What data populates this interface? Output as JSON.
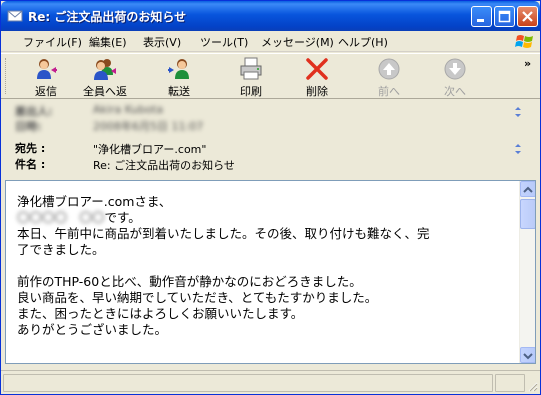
{
  "window": {
    "title": "Re: ご注文品出荷のお知らせ",
    "icons": [
      "envelope-icon",
      "minimize-icon",
      "maximize-icon",
      "close-icon"
    ]
  },
  "menu": {
    "items": [
      "ファイル(F)",
      "編集(E)",
      "表示(V)",
      "ツール(T)",
      "メッセージ(M)",
      "ヘルプ(H)"
    ]
  },
  "toolbar": {
    "buttons": [
      {
        "label": "返信",
        "icon": "reply-icon",
        "enabled": true
      },
      {
        "label": "全員へ返信",
        "icon": "reply-all-icon",
        "enabled": true
      },
      {
        "label": "転送",
        "icon": "forward-icon",
        "enabled": true
      },
      {
        "label": "印刷",
        "icon": "printer-icon",
        "enabled": true
      },
      {
        "label": "削除",
        "icon": "delete-icon",
        "enabled": true
      },
      {
        "label": "前へ",
        "icon": "previous-icon",
        "enabled": false
      },
      {
        "label": "次へ",
        "icon": "next-icon",
        "enabled": false
      }
    ],
    "overflow": "»"
  },
  "header": {
    "from_label": "差出人:",
    "from_value": "Akira Kubota",
    "date_label": "日時:",
    "date_value": "2008年6月5日 11:07",
    "to_label": "宛先 :",
    "to_value": "\"浄化槽ブロアー.com\"",
    "subject_label": "件名 :",
    "subject_value": "Re: ご注文品出荷のお知らせ"
  },
  "body": {
    "lines": [
      "浄化槽ブロアー.comさま、",
      "〇〇〇〇　〇〇です。",
      "本日、午前中に商品が到着いたしました。その後、取り付けも難なく、完",
      "了できました。",
      "",
      "前作のTHP-60と比べ、動作音が静かなのにおどろきました。",
      "良い商品を、早い納期でしていただき、とてもたすかりました。",
      "また、困ったときにはよろしくお願いいたします。",
      "ありがとうございました。"
    ],
    "redacted_line_1_prefix": "〇〇〇〇　〇〇",
    "redacted_line_1_suffix": "です。"
  },
  "colors": {
    "titlebar": "#0855dd",
    "chrome": "#ece9d8",
    "body_bg": "#ffffff",
    "delete_red": "#e0301e"
  }
}
